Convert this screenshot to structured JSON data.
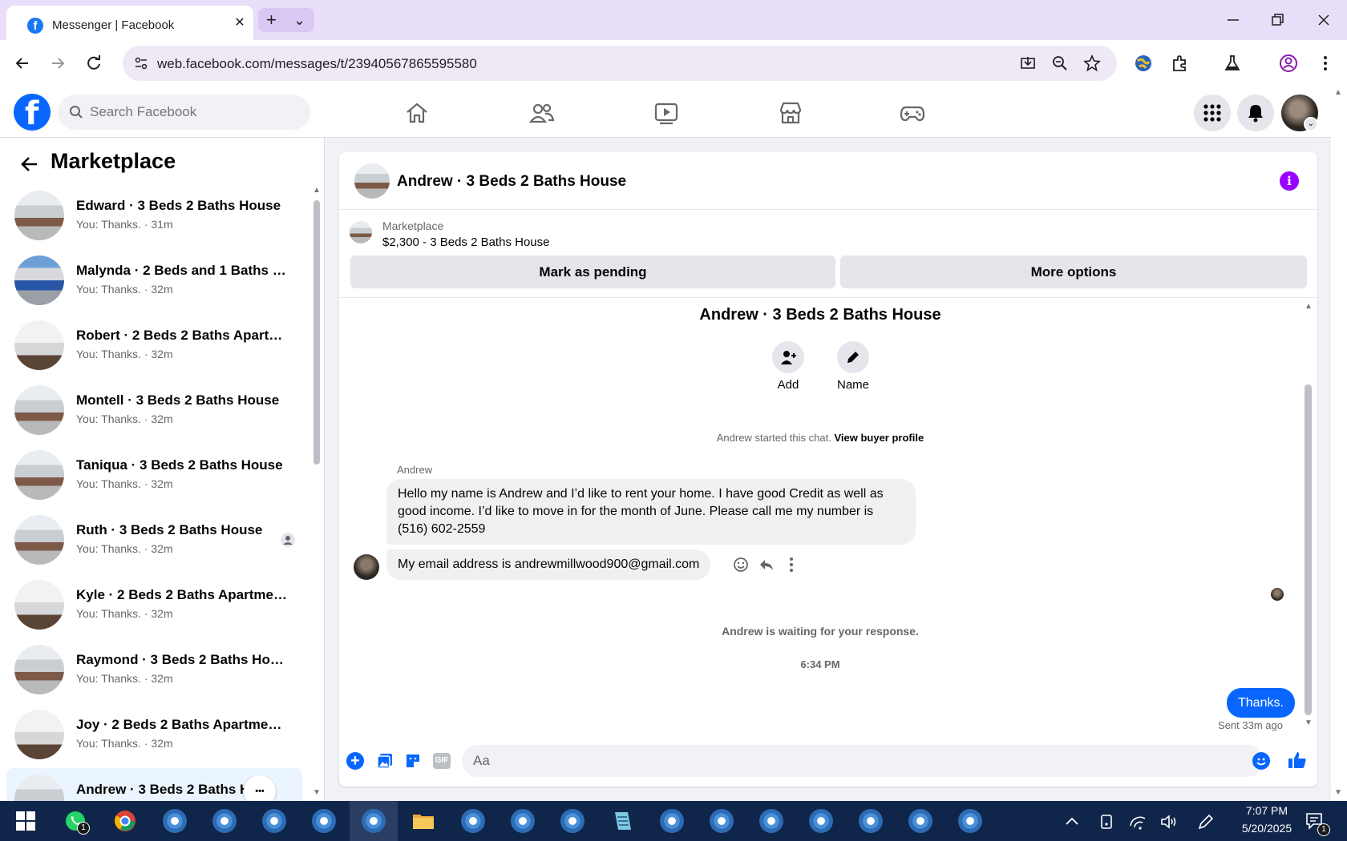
{
  "browser": {
    "tab_title": "Messenger | Facebook",
    "tab_favicon": "f",
    "url": "web.facebook.com/messages/t/23940567865595580",
    "tab_close": "✕",
    "new_tab": "+",
    "tab_list": "⌄"
  },
  "facebook": {
    "logo": "f",
    "search_placeholder": "Search Facebook"
  },
  "sidebar": {
    "title": "Marketplace",
    "conversations": [
      {
        "name": "Edward · 3 Beds 2 Baths House",
        "preview": "You: Thanks. · 31m",
        "thumb": "house"
      },
      {
        "name": "Malynda · 2 Beds and 1 Baths H...",
        "preview": "You: Thanks. · 32m",
        "thumb": "house2"
      },
      {
        "name": "Robert · 2 Beds 2 Baths Apartm...",
        "preview": "You: Thanks. · 32m",
        "thumb": "room"
      },
      {
        "name": "Montell · 3 Beds 2 Baths House",
        "preview": "You: Thanks. · 32m",
        "thumb": "house"
      },
      {
        "name": "Taniqua · 3 Beds 2 Baths House",
        "preview": "You: Thanks. · 32m",
        "thumb": "house"
      },
      {
        "name": "Ruth · 3 Beds 2 Baths House",
        "preview": "You: Thanks. · 32m",
        "thumb": "house"
      },
      {
        "name": "Kyle · 2 Beds 2 Baths Apartment...",
        "preview": "You: Thanks. · 32m",
        "thumb": "room"
      },
      {
        "name": "Raymond · 3 Beds 2 Baths House",
        "preview": "You: Thanks. · 32m",
        "thumb": "house"
      },
      {
        "name": "Joy · 2 Beds 2 Baths Apartment/...",
        "preview": "You: Thanks. · 32m",
        "thumb": "room"
      },
      {
        "name": "Andrew · 3 Beds 2 Baths Hou",
        "preview": "",
        "thumb": "house"
      }
    ]
  },
  "chat": {
    "title": "Andrew · 3 Beds 2 Baths House",
    "info": "i",
    "marketplace_label": "Marketplace",
    "listing": "$2,300 - 3 Beds 2 Baths House",
    "mark_pending": "Mark as pending",
    "more_options": "More options",
    "conversation_name": "Andrew · 3 Beds 2 Baths House",
    "add_label": "Add",
    "name_label": "Name",
    "started_text": "Andrew started this chat.",
    "view_profile": "View buyer profile",
    "sender": "Andrew",
    "message_1": "Hello my name is Andrew and I’d like to rent your home. I have good Credit as well as good income. I’d like to move in for the month of June. Please call me my number is (516) 602-2559",
    "message_2": "My email address is andrewmillwood900@gmail.com",
    "waiting": "Andrew is waiting for your response.",
    "time": "6:34 PM",
    "reply": "Thanks.",
    "sent_status": "Sent 33m ago",
    "composer_placeholder": "Aa",
    "gif": "GIF"
  },
  "taskbar": {
    "time": "7:07 PM",
    "date": "5/20/2025",
    "whatsapp_badge": "1",
    "notification_badge": "1"
  },
  "colors": {
    "accent": "#0866ff",
    "info_purple": "#9a00ff",
    "tab_strip": "#e9defa"
  }
}
